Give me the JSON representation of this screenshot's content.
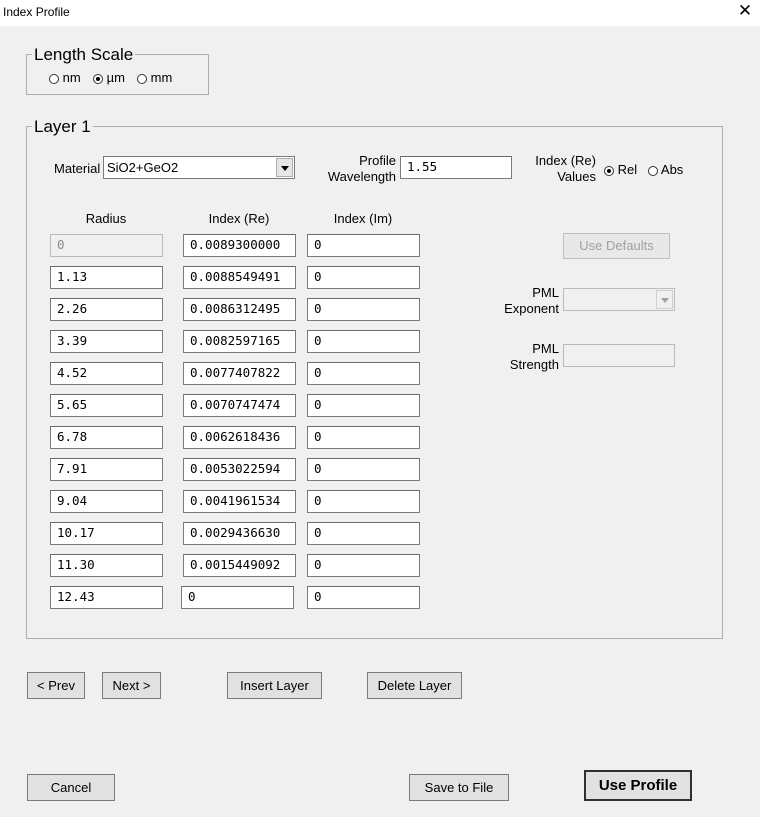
{
  "window": {
    "title": "Index Profile",
    "close_glyph": "✕"
  },
  "length_scale": {
    "legend": "Length Scale",
    "options": [
      {
        "label": "nm",
        "selected": false
      },
      {
        "label": "µm",
        "selected": true
      },
      {
        "label": "mm",
        "selected": false
      }
    ]
  },
  "layer": {
    "legend": "Layer 1",
    "material_label": "Material",
    "material_value": "SiO2+GeO2",
    "wavelength_label_1": "Profile",
    "wavelength_label_2": "Wavelength",
    "wavelength_value": "1.55",
    "index_values_label_1": "Index (Re)",
    "index_values_label_2": "Values",
    "index_values_options": [
      {
        "label": "Rel",
        "selected": true
      },
      {
        "label": "Abs",
        "selected": false
      }
    ],
    "headers": {
      "radius": "Radius",
      "index_re": "Index (Re)",
      "index_im": "Index (Im)"
    },
    "rows": [
      {
        "radius": "0",
        "re": "0.0089300000",
        "im": "0"
      },
      {
        "radius": "1.13",
        "re": "0.0088549491",
        "im": "0"
      },
      {
        "radius": "2.26",
        "re": "0.0086312495",
        "im": "0"
      },
      {
        "radius": "3.39",
        "re": "0.0082597165",
        "im": "0"
      },
      {
        "radius": "4.52",
        "re": "0.0077407822",
        "im": "0"
      },
      {
        "radius": "5.65",
        "re": "0.0070747474",
        "im": "0"
      },
      {
        "radius": "6.78",
        "re": "0.0062618436",
        "im": "0"
      },
      {
        "radius": "7.91",
        "re": "0.0053022594",
        "im": "0"
      },
      {
        "radius": "9.04",
        "re": "0.0041961534",
        "im": "0"
      },
      {
        "radius": "10.17",
        "re": "0.0029436630",
        "im": "0"
      },
      {
        "radius": "11.30",
        "re": "0.0015449092",
        "im": "0"
      },
      {
        "radius": "12.43",
        "re": "0",
        "im": "0"
      }
    ],
    "use_defaults_label": "Use Defaults",
    "pml_exponent_label_1": "PML",
    "pml_exponent_label_2": "Exponent",
    "pml_exponent_value": "",
    "pml_strength_label_1": "PML",
    "pml_strength_label_2": "Strength",
    "pml_strength_value": ""
  },
  "nav": {
    "prev_label": "< Prev",
    "next_label": "Next >",
    "insert_label": "Insert Layer",
    "delete_label": "Delete Layer"
  },
  "footer": {
    "cancel_label": "Cancel",
    "save_label": "Save to File",
    "use_profile_label": "Use Profile"
  }
}
